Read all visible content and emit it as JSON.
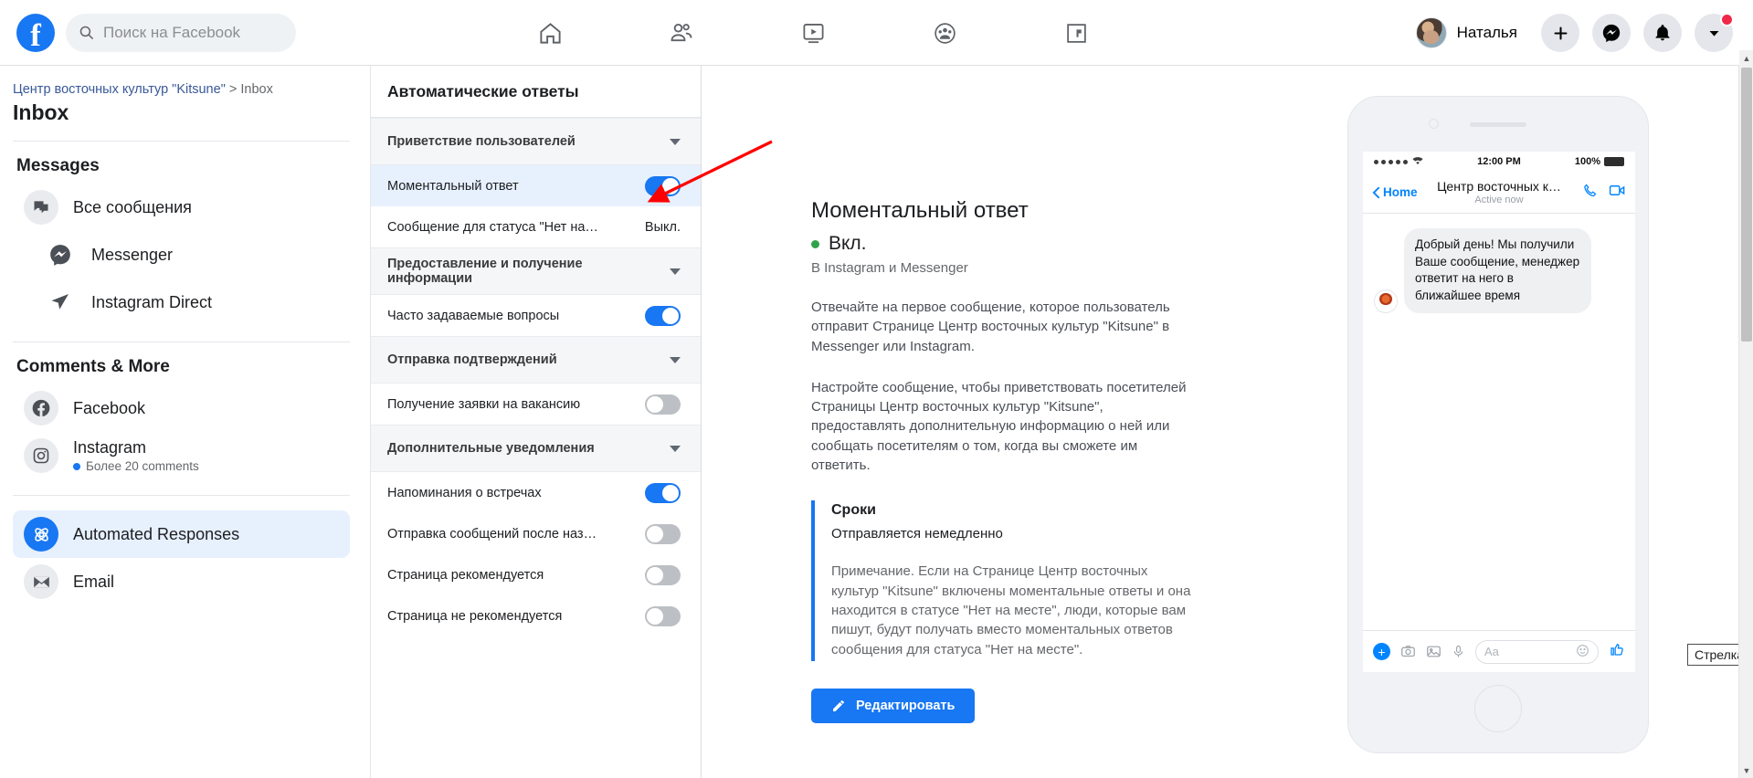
{
  "topbar": {
    "logo": "facebook-logo",
    "search": {
      "placeholder": "Поиск на Facebook",
      "value": ""
    },
    "nav": [
      {
        "name": "home-icon",
        "label": "Главная"
      },
      {
        "name": "friends-icon",
        "label": "Друзья"
      },
      {
        "name": "watch-icon",
        "label": "Видео"
      },
      {
        "name": "groups-icon",
        "label": "Группы"
      },
      {
        "name": "gaming-icon",
        "label": "Игры"
      }
    ],
    "profile_name": "Наталья",
    "actions": [
      {
        "name": "create-button",
        "glyph": "+"
      },
      {
        "name": "messenger-button",
        "glyph": "messenger"
      },
      {
        "name": "notifications-button",
        "glyph": "bell"
      },
      {
        "name": "account-menu-button",
        "glyph": "chevron-down",
        "badge": true
      }
    ]
  },
  "sidebar": {
    "breadcrumb_link": "Центр восточных культур \"Kitsune\"",
    "breadcrumb_sep": " > ",
    "breadcrumb_current": "Inbox",
    "page_title": "Inbox",
    "sections": [
      {
        "title": "Messages",
        "items": [
          {
            "label": "Все сообщения",
            "icon": "chat-bubbles-icon",
            "sub": ""
          },
          {
            "label": "Messenger",
            "icon": "messenger-icon",
            "sub": ""
          },
          {
            "label": "Instagram Direct",
            "icon": "direct-send-icon",
            "sub": ""
          }
        ]
      },
      {
        "title": "Comments & More",
        "items": [
          {
            "label": "Facebook",
            "icon": "facebook-icon",
            "sub": ""
          },
          {
            "label": "Instagram",
            "icon": "instagram-icon",
            "sub": "Более 20 comments"
          }
        ]
      }
    ],
    "bottom_items": [
      {
        "label": "Automated Responses",
        "icon": "automation-icon",
        "active": true
      },
      {
        "label": "Email",
        "icon": "email-icon",
        "active": false
      }
    ]
  },
  "midpanel": {
    "header": "Автоматические ответы",
    "rows": [
      {
        "type": "group",
        "label": "Приветствие пользователей"
      },
      {
        "type": "item",
        "label": "Моментальный ответ",
        "control": "toggle-on",
        "selected": true
      },
      {
        "type": "item",
        "label": "Сообщение для статуса \"Нет на месте\"",
        "control": "text",
        "status": "Выкл."
      },
      {
        "type": "group",
        "label": "Предоставление и получение информации"
      },
      {
        "type": "item",
        "label": "Часто задаваемые вопросы",
        "control": "toggle-on"
      },
      {
        "type": "group",
        "label": "Отправка подтверждений"
      },
      {
        "type": "item",
        "label": "Получение заявки на вакансию",
        "control": "toggle-off"
      },
      {
        "type": "group",
        "label": "Дополнительные уведомления"
      },
      {
        "type": "item",
        "label": "Напоминания о встречах",
        "control": "toggle-on"
      },
      {
        "type": "item",
        "label": "Отправка сообщений после назначени…",
        "control": "toggle-off"
      },
      {
        "type": "item",
        "label": "Страница рекомендуется",
        "control": "toggle-off"
      },
      {
        "type": "item",
        "label": "Страница не рекомендуется",
        "control": "toggle-off"
      }
    ]
  },
  "detail": {
    "title": "Моментальный ответ",
    "state": "Вкл.",
    "platforms": "В Instagram и Messenger",
    "paragraph1": "Отвечайте на первое сообщение, которое пользователь отправит Странице Центр восточных культур \"Kitsune\" в Messenger или Instagram.",
    "paragraph2": "Настройте сообщение, чтобы приветствовать посетителей Страницы Центр восточных культур \"Kitsune\", предоставлять дополнительную информацию о ней или сообщать посетителям о том, когда вы сможете им ответить.",
    "callout_title": "Сроки",
    "callout_sub": "Отправляется немедленно",
    "callout_note": "Примечание. Если на Странице Центр восточных культур \"Kitsune\" включены моментальные ответы и она находится в статусе \"Нет на месте\", люди, которые вам пишут, будут получать вместо моментальных ответов сообщения для статуса \"Нет на месте\".",
    "edit_button": "Редактировать"
  },
  "phone": {
    "status_time": "12:00 PM",
    "status_battery": "100%",
    "back_label": "Home",
    "conversation_title": "Центр восточных к…",
    "active_status": "Active now",
    "message": "Добрый день! Мы получили Ваше сообщение, менеджер ответит на него в ближайшее время",
    "compose_placeholder": "Aa"
  },
  "annotations": {
    "tooltip": "Стрелка",
    "arrow_color": "#ff0000"
  }
}
